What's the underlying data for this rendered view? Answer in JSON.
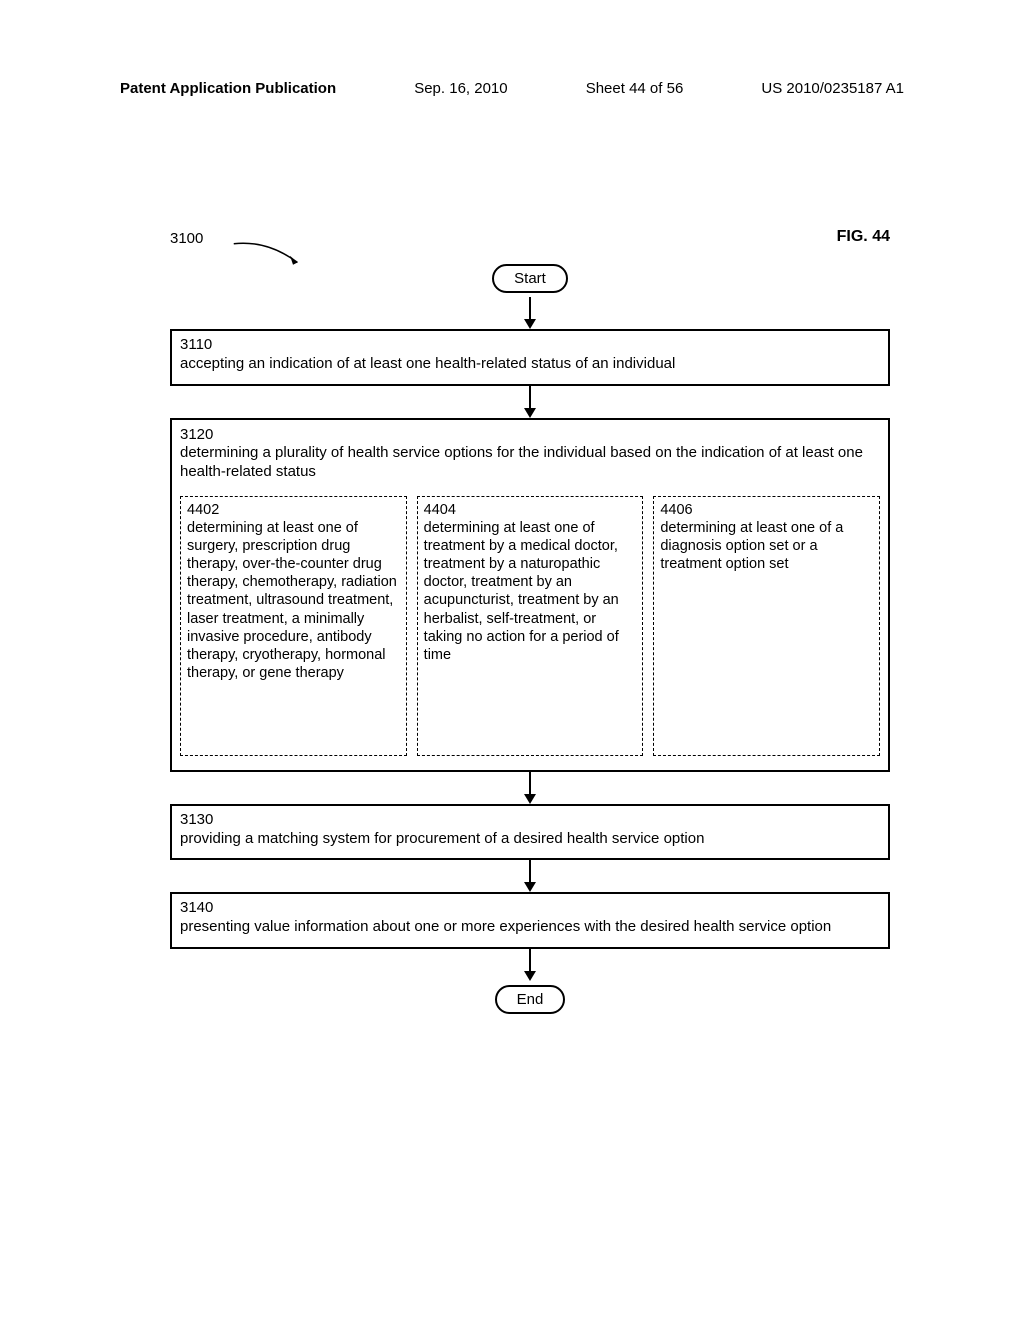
{
  "header": {
    "left": "Patent Application Publication",
    "date": "Sep. 16, 2010",
    "sheet": "Sheet 44 of 56",
    "pubnum": "US 2010/0235187 A1"
  },
  "fig": {
    "ref": "3100",
    "label": "FIG. 44",
    "start": "Start",
    "end": "End"
  },
  "steps": {
    "s3110": {
      "num": "3110",
      "text": "accepting an indication of at least one health-related status of an individual"
    },
    "s3120": {
      "num": "3120",
      "text": "determining a plurality of health service options for the individual based on the indication of at least one health-related status"
    },
    "s3130": {
      "num": "3130",
      "text": "providing a matching system for procurement of a desired health service option"
    },
    "s3140": {
      "num": "3140",
      "text": "presenting value information about one or more experiences with the desired health service option"
    }
  },
  "subs": {
    "s4402": {
      "num": "4402",
      "text": "determining at least one of surgery, prescription drug therapy, over-the-counter drug therapy, chemotherapy, radiation treatment, ultrasound treatment, laser treatment, a minimally invasive procedure, antibody therapy, cryotherapy, hormonal therapy, or gene therapy"
    },
    "s4404": {
      "num": "4404",
      "text": "determining at least one of treatment by a medical doctor, treatment by a naturopathic doctor, treatment by an acupuncturist, treatment by an herbalist, self-treatment, or taking no action for a period of time"
    },
    "s4406": {
      "num": "4406",
      "text": "determining at least one of a diagnosis option set or a treatment option set"
    }
  }
}
